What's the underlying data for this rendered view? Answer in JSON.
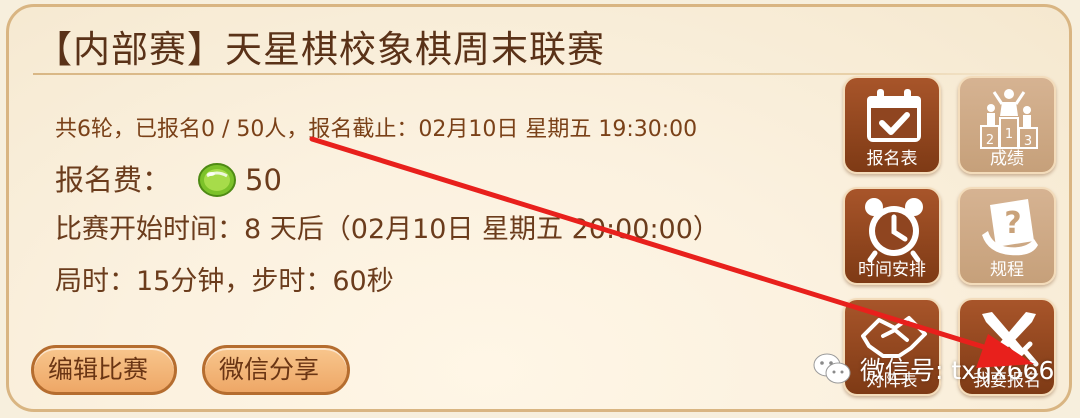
{
  "match": {
    "title": "【内部赛】天星棋校象棋周末联赛",
    "summary_line": "共6轮，已报名0 / 50人，报名截止：02月10日 星期五 19:30:00",
    "fee_label": "报名费：",
    "fee_amount": "50",
    "start_line": "比赛开始时间：8 天后（02月10日 星期五 20:00:00）",
    "time_control_line": "局时：15分钟，步时：60秒"
  },
  "buttons": {
    "edit": "编辑比赛",
    "share": "微信分享"
  },
  "tiles": {
    "signup_sheet": "报名表",
    "results": "成绩",
    "schedule": "时间安排",
    "rules": "规程",
    "pairing": "对阵表",
    "join": "我要报名"
  },
  "podium_numbers": [
    "2",
    "1",
    "3"
  ],
  "watermark": "微信号: txqx666",
  "colors": {
    "tile_active": "#8f4520",
    "tile_disabled": "#d0ab86",
    "arrow": "#e8201c",
    "title_text": "#5a3218"
  },
  "icons": [
    "calendar-check-icon",
    "podium-icon",
    "alarm-clock-icon",
    "question-scroll-icon",
    "handshake-icon",
    "crossed-swords-icon",
    "lime-coin-icon",
    "wechat-icon"
  ]
}
